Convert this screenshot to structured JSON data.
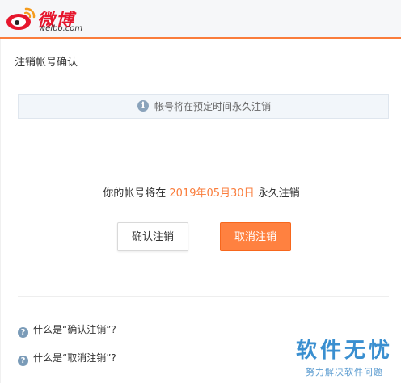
{
  "header": {
    "logo_text": "微博",
    "logo_sub": "weibo.com"
  },
  "panel": {
    "title": "注销帐号确认",
    "notice": "帐号将在预定时间永久注销",
    "message_prefix": "你的帐号将在",
    "message_date": "2019年05月30日",
    "message_suffix": "永久注销",
    "confirm_button": "确认注销",
    "cancel_button": "取消注销"
  },
  "faq": [
    {
      "label": "什么是“确认注销”?"
    },
    {
      "label": "什么是“取消注销”?"
    }
  ],
  "watermark": {
    "main": "软件无忧",
    "sub": "努力解决软件问题"
  },
  "colors": {
    "accent": "#fa7d3c",
    "brand_red": "#e6162d",
    "cancel_bg": "#ff8140"
  },
  "icons": [
    "weibo-logo-icon",
    "info-icon",
    "help-icon"
  ]
}
